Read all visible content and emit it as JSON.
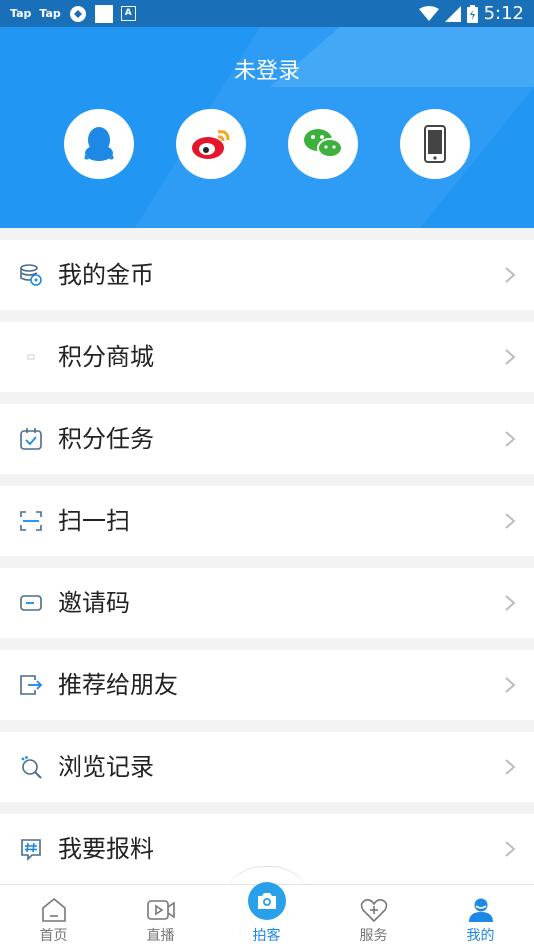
{
  "status_bar": {
    "left_items": [
      "Tap",
      "Tap"
    ],
    "time": "5:12"
  },
  "header": {
    "title": "未登录",
    "login_options": [
      {
        "name": "qq-icon",
        "color": "#1e88e5"
      },
      {
        "name": "weibo-icon",
        "color": "#e6162d"
      },
      {
        "name": "wechat-icon",
        "color": "#3db03d"
      },
      {
        "name": "phone-icon",
        "color": "#444444"
      }
    ]
  },
  "menu": {
    "items": [
      {
        "label": "我的金币",
        "icon": "coin-stack-icon"
      },
      {
        "label": "积分商城",
        "icon": "image-placeholder-icon"
      },
      {
        "label": "积分任务",
        "icon": "calendar-check-icon"
      },
      {
        "label": "扫一扫",
        "icon": "scan-icon"
      },
      {
        "label": "邀请码",
        "icon": "ticket-icon"
      },
      {
        "label": "推荐给朋友",
        "icon": "share-exit-icon"
      },
      {
        "label": "浏览记录",
        "icon": "browse-history-icon"
      },
      {
        "label": "我要报料",
        "icon": "hashtag-message-icon"
      }
    ]
  },
  "bottom_nav": {
    "items": [
      {
        "label": "首页",
        "icon": "home-icon",
        "active": false
      },
      {
        "label": "直播",
        "icon": "live-video-icon",
        "active": false
      },
      {
        "label": "拍客",
        "icon": "camera-icon",
        "active": false
      },
      {
        "label": "服务",
        "icon": "heart-plus-icon",
        "active": false
      },
      {
        "label": "我的",
        "icon": "user-icon",
        "active": true
      }
    ]
  },
  "colors": {
    "header_bg": "#2196f3",
    "status_bg": "#1a70b8",
    "accent": "#1e88e5",
    "menu_icon": "#4a6d8c"
  }
}
